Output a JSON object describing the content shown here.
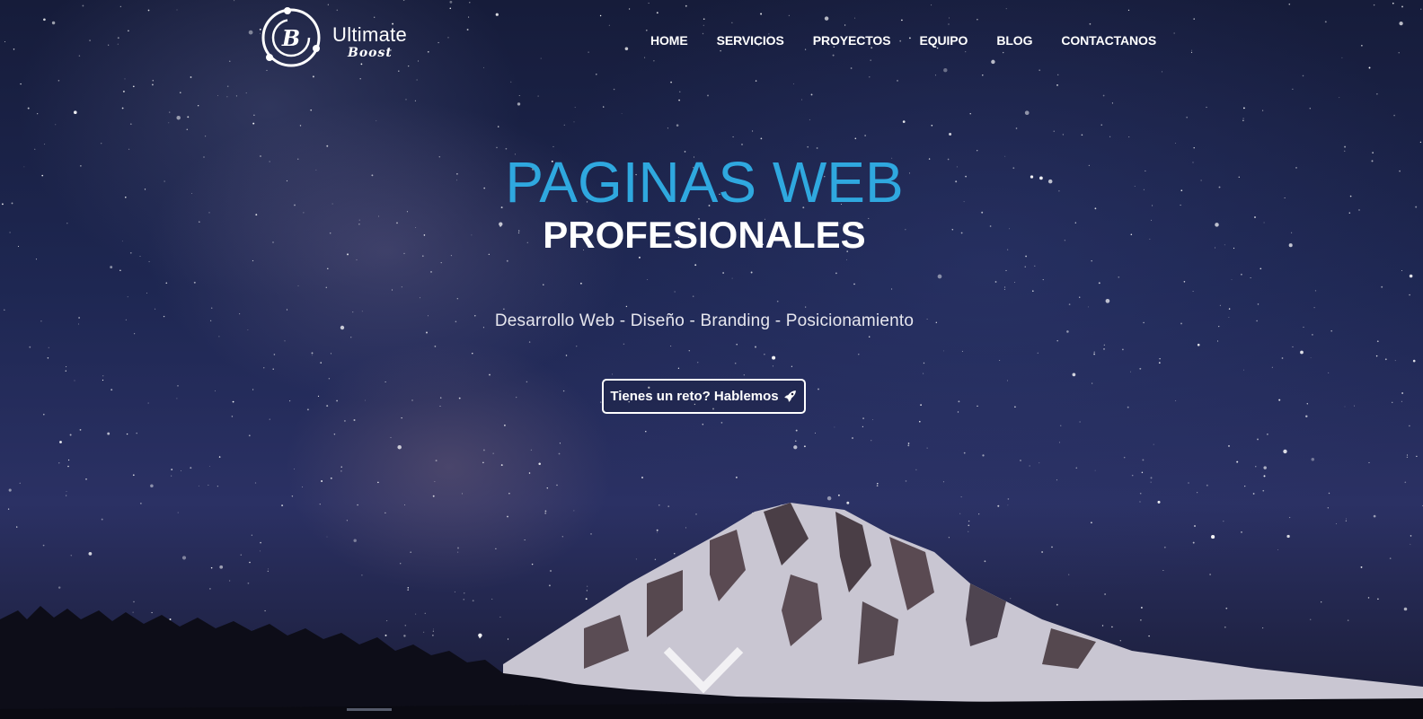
{
  "brand": {
    "name": "Ultimate",
    "sub": "Boost",
    "mark_letter": "B"
  },
  "nav": {
    "items": [
      {
        "label": "HOME"
      },
      {
        "label": "SERVICIOS"
      },
      {
        "label": "PROYECTOS"
      },
      {
        "label": "EQUIPO"
      },
      {
        "label": "BLOG"
      },
      {
        "label": "CONTACTANOS"
      }
    ]
  },
  "hero": {
    "headline": "PAGINAS WEB",
    "subheadline": "PROFESIONALES",
    "tagline": "Desarrollo Web - Diseño - Branding - Posicionamiento",
    "cta_label": "Tienes un reto? Hablemos",
    "cta_icon": "rocket-icon",
    "scroll_icon": "chevron-down-icon"
  },
  "colors": {
    "accent": "#2fa8df",
    "text": "#ffffff",
    "sky_dark": "#161c3a"
  }
}
